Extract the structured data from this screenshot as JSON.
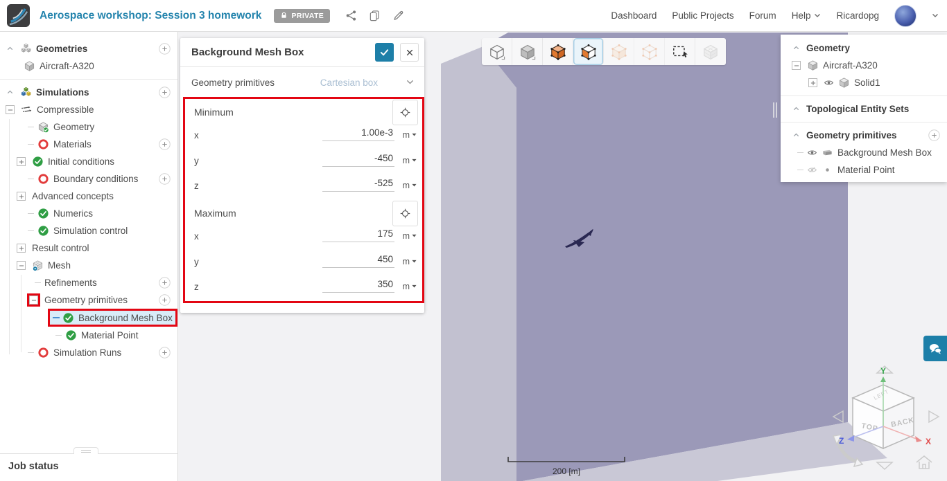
{
  "header": {
    "title": "Aerospace workshop: Session 3 homework",
    "privacy_badge": "PRIVATE",
    "action_icons": [
      "share-icon",
      "duplicate-icon",
      "edit-icon"
    ],
    "nav_items": [
      "Dashboard",
      "Public Projects",
      "Forum",
      "Help"
    ],
    "username": "Ricardopg"
  },
  "left_tree": {
    "rows": [
      {
        "label": "Geometries",
        "icon": "cubes-gray",
        "expander": "chevron",
        "plus": true,
        "indent": 8,
        "bold": true
      },
      {
        "label": "Aircraft-A320",
        "icon": "cube-gray",
        "indent": 34
      },
      {
        "label": "Simulations",
        "icon": "cubes-color",
        "expander": "chevron",
        "plus": true,
        "indent": 8,
        "bold": true,
        "divider_before": true
      },
      {
        "label": "Compressible",
        "icon": "flow",
        "expander": "minusbox",
        "indent": 8
      },
      {
        "label": "Geometry",
        "icon": "cube-check",
        "indent": 40,
        "tick": true
      },
      {
        "label": "Materials",
        "icon": "red-o",
        "plus": true,
        "indent": 40,
        "tick": true
      },
      {
        "label": "Initial conditions",
        "icon": "green-check",
        "expander": "plusbox",
        "indent": 24
      },
      {
        "label": "Boundary conditions",
        "icon": "red-o",
        "plus": true,
        "indent": 40,
        "tick": true
      },
      {
        "label": "Advanced concepts",
        "expander": "plusbox",
        "indent": 24
      },
      {
        "label": "Numerics",
        "icon": "green-check",
        "indent": 40,
        "tick": true
      },
      {
        "label": "Simulation control",
        "icon": "green-check",
        "indent": 40,
        "tick": true
      },
      {
        "label": "Result control",
        "expander": "plusbox",
        "indent": 24
      },
      {
        "label": "Mesh",
        "icon": "mesh",
        "expander": "minusbox",
        "indent": 24
      },
      {
        "label": "Refinements",
        "plus": true,
        "indent": 50,
        "tick": true
      },
      {
        "label": "Geometry primitives",
        "expander": "minusbox",
        "expander_highlight": true,
        "plus": true,
        "indent": 42
      },
      {
        "label": "Background Mesh Box",
        "icon": "green-check",
        "selected": true,
        "indent": 69
      },
      {
        "label": "Material Point",
        "icon": "green-check",
        "indent": 80,
        "tick": true
      },
      {
        "label": "Simulation Runs",
        "icon": "red-o",
        "plus": true,
        "indent": 40,
        "tick": true
      }
    ]
  },
  "panel": {
    "title": "Background Mesh Box",
    "type_label": "Geometry primitives",
    "type_value": "Cartesian box",
    "sections": [
      {
        "name": "Minimum",
        "fields": [
          {
            "axis": "x",
            "value": "1.00e-3",
            "unit": "m"
          },
          {
            "axis": "y",
            "value": "-450",
            "unit": "m"
          },
          {
            "axis": "z",
            "value": "-525",
            "unit": "m"
          }
        ]
      },
      {
        "name": "Maximum",
        "fields": [
          {
            "axis": "x",
            "value": "175",
            "unit": "m"
          },
          {
            "axis": "y",
            "value": "450",
            "unit": "m"
          },
          {
            "axis": "z",
            "value": "350",
            "unit": "m"
          }
        ]
      }
    ]
  },
  "right_tree": {
    "rows": [
      {
        "label": "Geometry",
        "expander": "chevron",
        "bold": true,
        "indent": 16
      },
      {
        "label": "Aircraft-A320",
        "expander": "minusbox",
        "icon": "cube-gray",
        "indent": 16
      },
      {
        "label": "Solid1",
        "expander": "plusbox",
        "eye": "open",
        "icon": "cube-gray",
        "indent": 40
      },
      {
        "label": "Topological Entity Sets",
        "expander": "chevron",
        "bold": true,
        "indent": 16,
        "divider_before": true
      },
      {
        "label": "Geometry primitives",
        "expander": "chevron",
        "bold": true,
        "plus": true,
        "indent": 16,
        "divider_before": true
      },
      {
        "label": "Background Mesh Box",
        "eye": "open",
        "icon": "box-solid",
        "indent": 24,
        "tick": true
      },
      {
        "label": "Material Point",
        "eye": "off",
        "icon": "dot",
        "indent": 24,
        "tick": true
      }
    ]
  },
  "viewport": {
    "toolbar": [
      {
        "name": "wireframe-view",
        "state": "normal"
      },
      {
        "name": "solid-view",
        "state": "normal"
      },
      {
        "name": "solid-vertices-view",
        "state": "normal"
      },
      {
        "name": "face-select",
        "state": "active"
      },
      {
        "name": "vertex-select",
        "state": "disabled"
      },
      {
        "name": "edge-select",
        "state": "disabled"
      },
      {
        "name": "box-select",
        "state": "normal"
      },
      {
        "name": "mesh-view",
        "state": "disabled"
      }
    ],
    "scale_label": "200 [m]",
    "gizmo": {
      "faces": {
        "left_face": "TOP",
        "right_face": "BACK",
        "top_face": "LEFT"
      },
      "axes": {
        "x": "X",
        "y": "Y",
        "z": "Z"
      }
    }
  },
  "job_status_label": "Job status",
  "colors": {
    "accent": "#1d7fa8",
    "annotation": "#e30613",
    "selection_bg": "#d9ecf8",
    "title_blue": "#2484ad",
    "box_face": "#9b99b8",
    "box_face_light": "#c2c1d0",
    "floor": "#c9c8d6"
  }
}
